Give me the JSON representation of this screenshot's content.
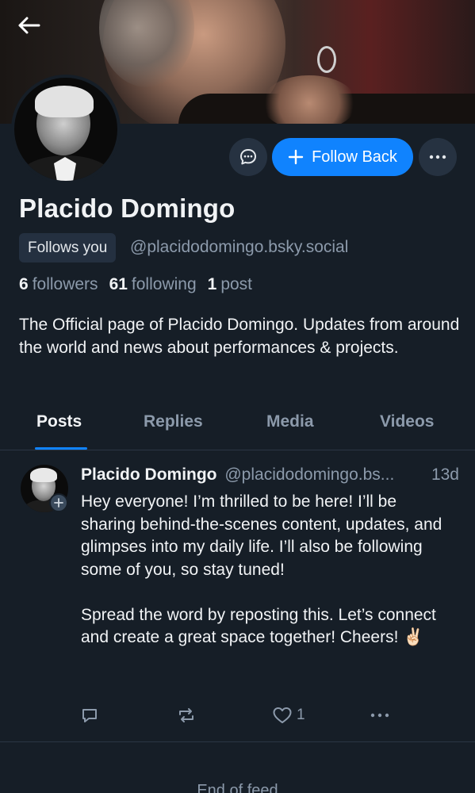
{
  "profile": {
    "display_name": "Placido Domingo",
    "follows_you_label": "Follows you",
    "handle": "@placidodomingo.bsky.social",
    "stats": {
      "followers_count": "6",
      "followers_label": "followers",
      "following_count": "61",
      "following_label": "following",
      "posts_count": "1",
      "posts_label": "post"
    },
    "bio": "The Official page of Placido Domingo. Updates from around the world and news about performances & projects."
  },
  "actions": {
    "follow_back_label": "Follow Back"
  },
  "tabs": [
    {
      "label": "Posts",
      "active": true
    },
    {
      "label": "Replies",
      "active": false
    },
    {
      "label": "Media",
      "active": false
    },
    {
      "label": "Videos",
      "active": false
    }
  ],
  "post": {
    "author": "Placido Domingo",
    "handle": "@placidodomingo.bs...",
    "time": "13d",
    "text": "Hey everyone! I’m thrilled to be here! I’ll be sharing behind-the-scenes content, updates, and glimpses into my daily life. I’ll also be following some of you, so stay tuned!\n\nSpread the word by reposting this. Let’s connect and create a great space together! Cheers! ✌🏻",
    "like_count": "1"
  },
  "feed": {
    "end_label": "End of feed"
  },
  "colors": {
    "background": "#161e27",
    "accent": "#1083fe",
    "muted_text": "#8c9aab"
  },
  "icons": [
    "back-arrow-icon",
    "chat-icon",
    "plus-icon",
    "ellipsis-icon",
    "reply-icon",
    "repost-icon",
    "heart-icon"
  ]
}
